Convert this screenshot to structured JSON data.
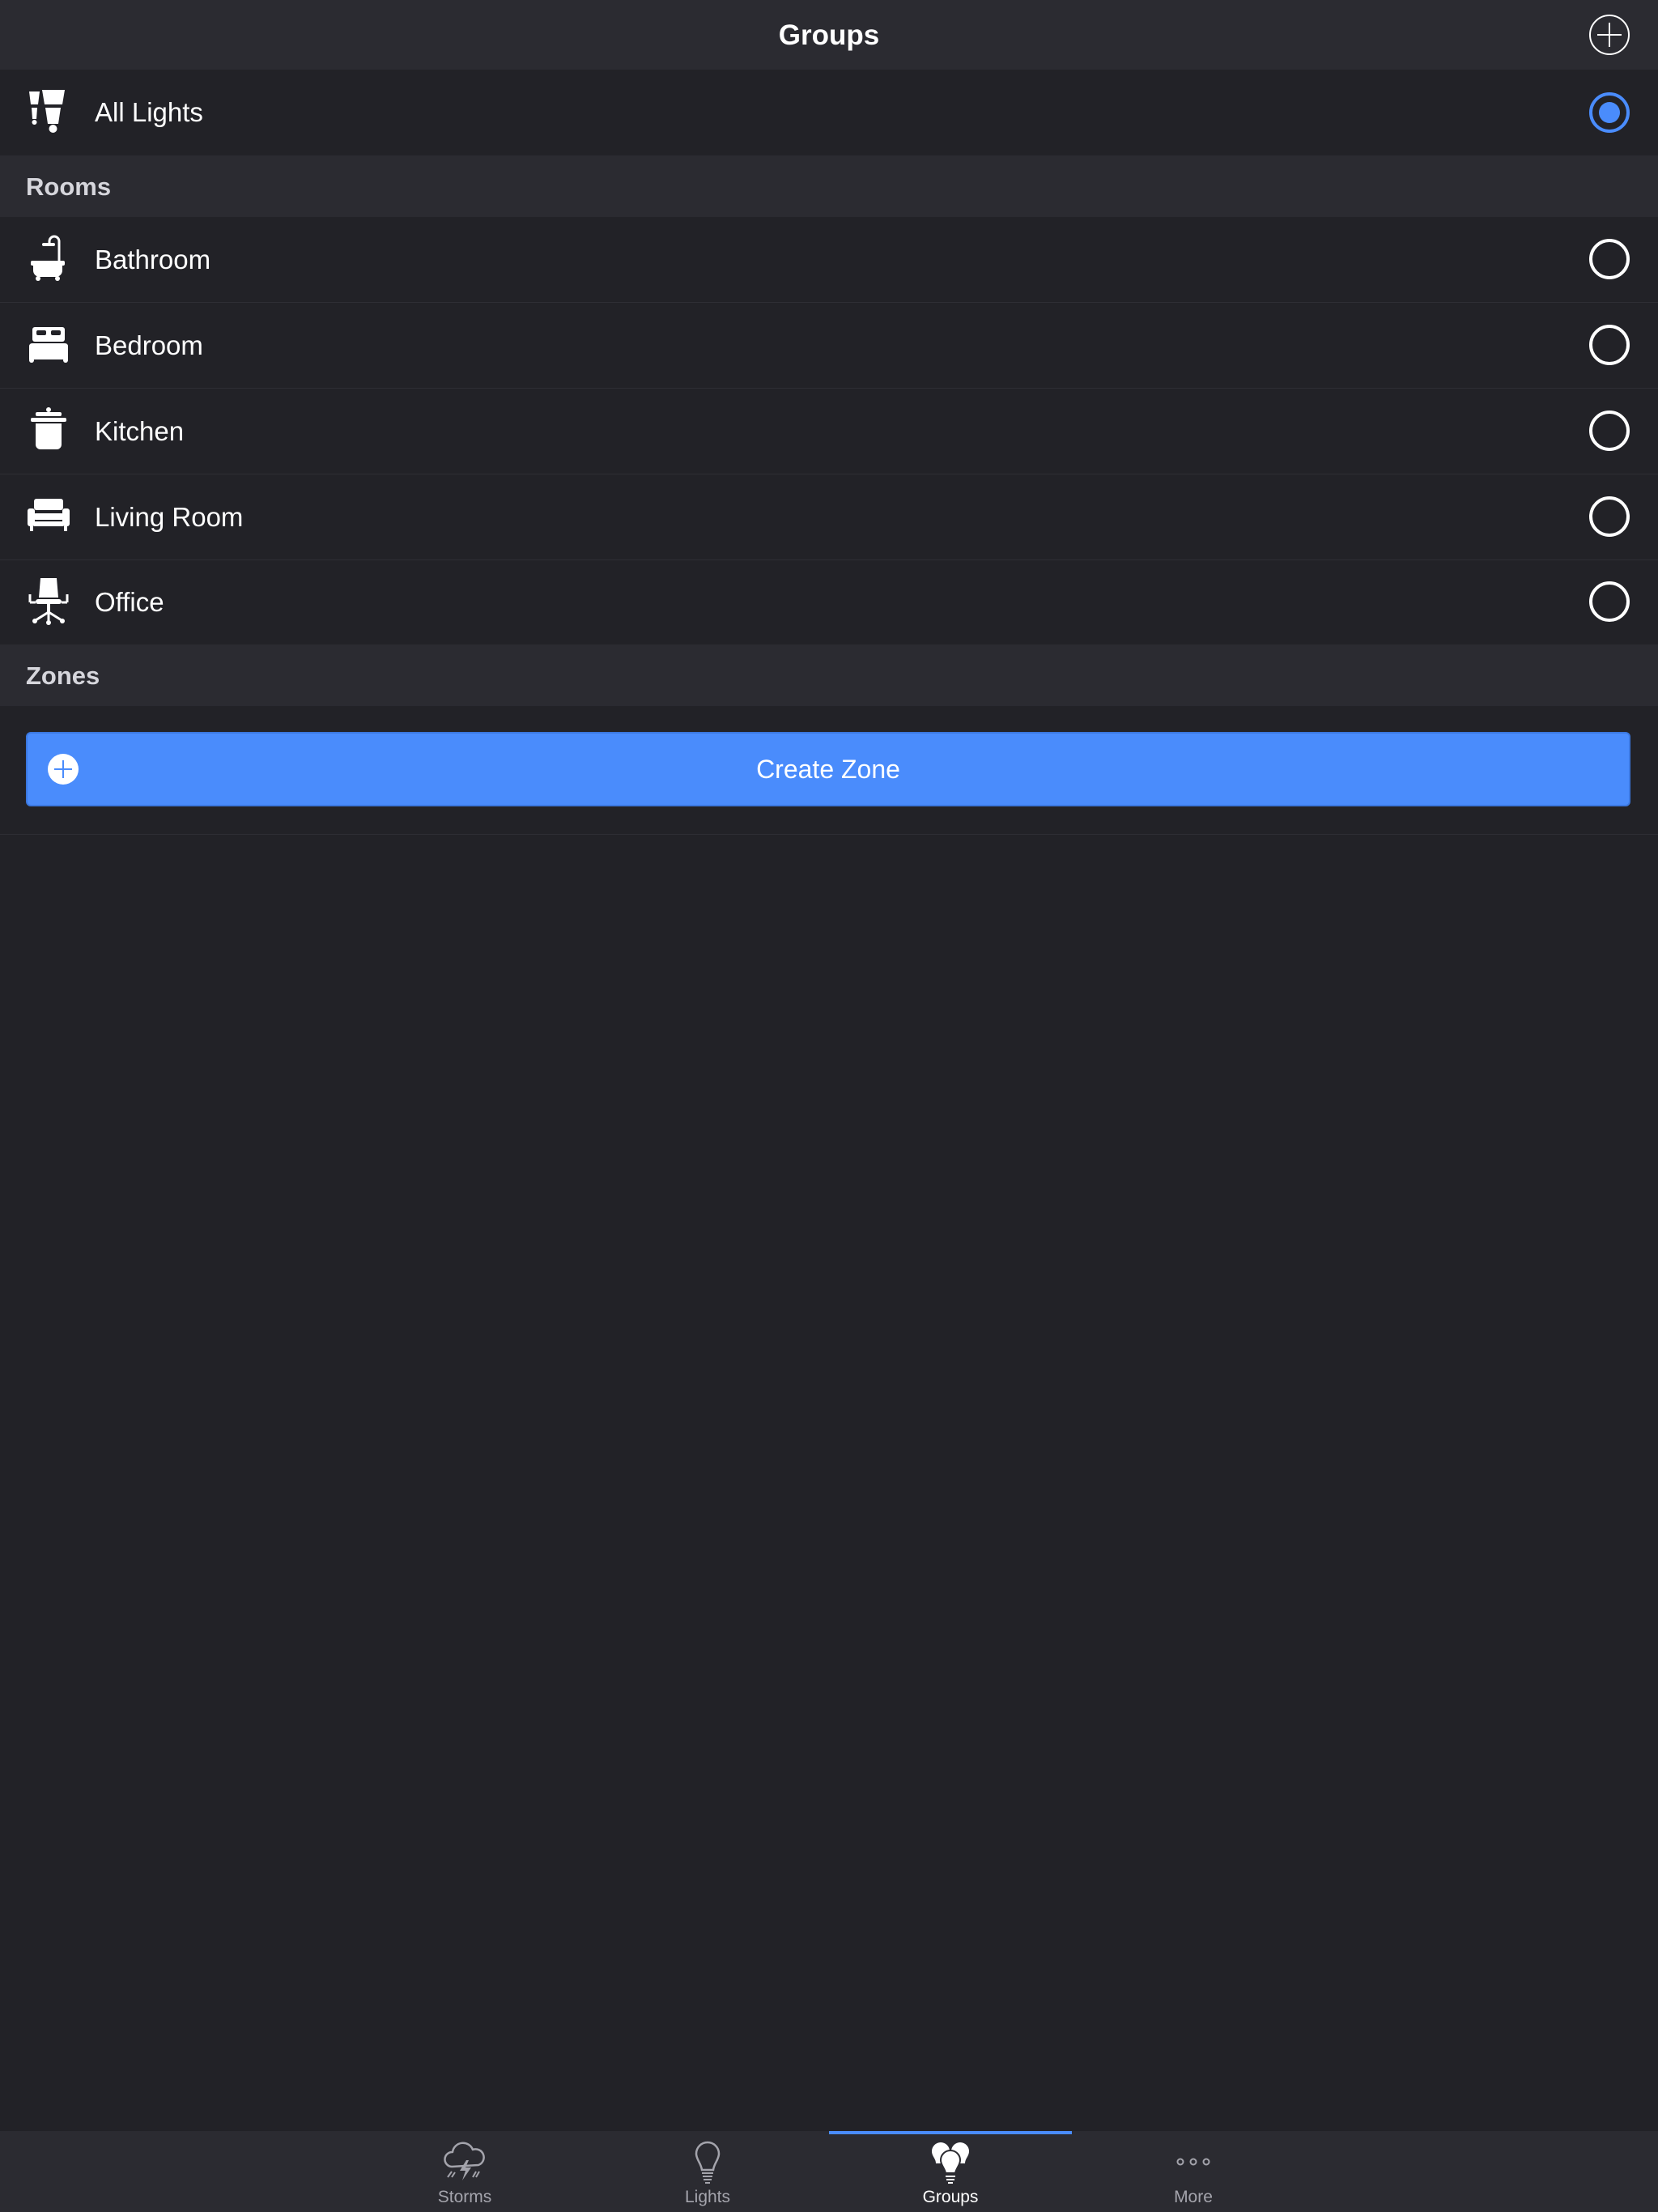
{
  "navbar": {
    "title": "Groups",
    "add_icon": "plus-circle-icon"
  },
  "all_lights": {
    "label": "All Lights",
    "icon": "lamps-icon",
    "selected": true
  },
  "sections": {
    "rooms": {
      "label": "Rooms"
    },
    "zones": {
      "label": "Zones"
    }
  },
  "rooms": [
    {
      "label": "Bathroom",
      "icon": "bathtub-icon",
      "selected": false
    },
    {
      "label": "Bedroom",
      "icon": "bed-icon",
      "selected": false
    },
    {
      "label": "Kitchen",
      "icon": "pot-icon",
      "selected": false
    },
    {
      "label": "Living Room",
      "icon": "sofa-icon",
      "selected": false
    },
    {
      "label": "Office",
      "icon": "office-chair-icon",
      "selected": false
    }
  ],
  "zones": {
    "create_label": "Create Zone",
    "create_icon": "plus-circle-icon"
  },
  "tabbar": {
    "tabs": [
      {
        "label": "Storms",
        "icon": "storm-cloud-icon",
        "active": false
      },
      {
        "label": "Lights",
        "icon": "light-bulb-icon",
        "active": false
      },
      {
        "label": "Groups",
        "icon": "bulb-group-icon",
        "active": true
      },
      {
        "label": "More",
        "icon": "more-dots-icon",
        "active": false
      }
    ]
  },
  "colors": {
    "accent": "#4a8cfc",
    "background": "#222227",
    "bar": "#2b2b31"
  }
}
